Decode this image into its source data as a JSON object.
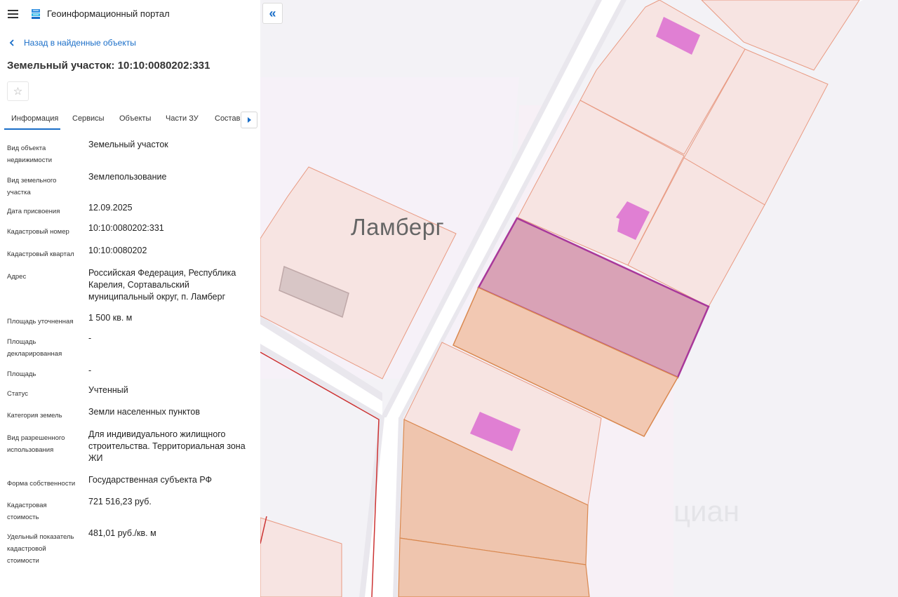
{
  "header": {
    "app_title": "Геоинформационный портал",
    "menu_icon": "menu-icon",
    "logo_icon": "portal-logo-icon"
  },
  "nav": {
    "back_label": "Назад в найденные объекты"
  },
  "object": {
    "title": "Земельный участок: 10:10:0080202:331"
  },
  "tabs": [
    {
      "label": "Информация",
      "active": true
    },
    {
      "label": "Сервисы",
      "active": false
    },
    {
      "label": "Объекты",
      "active": false
    },
    {
      "label": "Части ЗУ",
      "active": false
    },
    {
      "label": "Состав",
      "active": false
    }
  ],
  "properties": [
    {
      "label": "Вид объекта недвижимости",
      "value": "Земельный участок"
    },
    {
      "label": "Вид земельного участка",
      "value": "Землепользование"
    },
    {
      "label": "Дата присвоения",
      "value": "12.09.2025"
    },
    {
      "label": "Кадастровый номер",
      "value": "10:10:0080202:331"
    },
    {
      "label": "Кадастровый квартал",
      "value": "10:10:0080202"
    },
    {
      "label": "Адрес",
      "value": "Российская Федерация, Республика Карелия, Сортавальский муниципальный округ, п. Ламберг"
    },
    {
      "label": "Площадь уточненная",
      "value": "1 500 кв. м"
    },
    {
      "label": "Площадь декларированная",
      "value": "-"
    },
    {
      "label": "Площадь",
      "value": "-"
    },
    {
      "label": "Статус",
      "value": "Учтенный"
    },
    {
      "label": "Категория земель",
      "value": "Земли населенных пунктов"
    },
    {
      "label": "Вид разрешенного использования",
      "value": "Для индивидуального жилищного строительства. Территориальная зона ЖИ"
    },
    {
      "label": "Форма собственности",
      "value": "Государственная субъекта РФ"
    },
    {
      "label": "Кадастровая стоимость",
      "value": "721 516,23 руб."
    },
    {
      "label": "Удельный показатель кадастровой стоимости",
      "value": "481,01 руб./кв. м"
    }
  ],
  "map": {
    "place_label": "Ламберг",
    "watermark": "циан",
    "collapse_label": "«",
    "colors": {
      "background": "#f3f2f6",
      "parcel_fill": "#f7e4e2",
      "parcel_stroke": "#e89a82",
      "selected_fill": "#d9a2b6",
      "selected_stroke": "#a8389a",
      "building": "#e07fd3",
      "road": "#ffffff",
      "boundary": "#cc3333"
    }
  }
}
